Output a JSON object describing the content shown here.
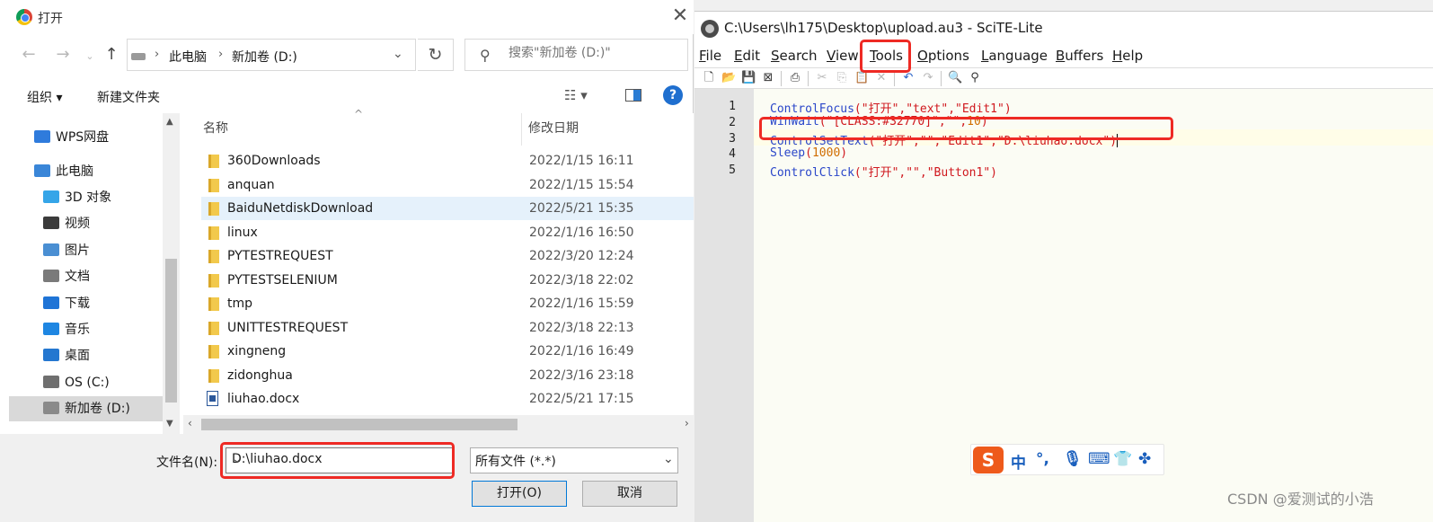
{
  "dialog": {
    "title": "打开",
    "address": {
      "seg1": "此电脑",
      "seg2": "新加卷 (D:)"
    },
    "search_placeholder": "搜索\"新加卷 (D:)\"",
    "cmd": {
      "organize": "组织 ▾",
      "new_folder": "新建文件夹"
    },
    "nav_items": [
      {
        "label": "WPS网盘",
        "icon": "cloud-icon",
        "color": "#2f7bdc"
      },
      {
        "label": "此电脑",
        "icon": "computer-icon",
        "color": "#3a86d8"
      },
      {
        "label": "3D 对象",
        "icon": "cube-icon",
        "color": "#35a5e8"
      },
      {
        "label": "视频",
        "icon": "video-icon",
        "color": "#3b3b3b"
      },
      {
        "label": "图片",
        "icon": "picture-icon",
        "color": "#4a8fd3"
      },
      {
        "label": "文档",
        "icon": "document-icon",
        "color": "#7a7a7a"
      },
      {
        "label": "下载",
        "icon": "download-icon",
        "color": "#1f74d6"
      },
      {
        "label": "音乐",
        "icon": "music-icon",
        "color": "#1e86e2"
      },
      {
        "label": "桌面",
        "icon": "desktop-icon",
        "color": "#2477d0"
      },
      {
        "label": "OS (C:)",
        "icon": "windows-drive-icon",
        "color": "#6f6f6f"
      },
      {
        "label": "新加卷 (D:)",
        "icon": "drive-icon",
        "color": "#8a8a8a"
      }
    ],
    "columns": {
      "name": "名称",
      "date": "修改日期"
    },
    "files": [
      {
        "name": "360Downloads",
        "date": "2022/1/15 16:11",
        "type": "folder"
      },
      {
        "name": "anquan",
        "date": "2022/1/15 15:54",
        "type": "folder"
      },
      {
        "name": "BaiduNetdiskDownload",
        "date": "2022/5/21 15:35",
        "type": "folder"
      },
      {
        "name": "linux",
        "date": "2022/1/16 16:50",
        "type": "folder"
      },
      {
        "name": "PYTESTREQUEST",
        "date": "2022/3/20 12:24",
        "type": "folder"
      },
      {
        "name": "PYTESTSELENIUM",
        "date": "2022/3/18 22:02",
        "type": "folder"
      },
      {
        "name": "tmp",
        "date": "2022/1/16 15:59",
        "type": "folder"
      },
      {
        "name": "UNITTESTREQUEST",
        "date": "2022/3/18 22:13",
        "type": "folder"
      },
      {
        "name": "xingneng",
        "date": "2022/1/16 16:49",
        "type": "folder"
      },
      {
        "name": "zidonghua",
        "date": "2022/3/16 23:18",
        "type": "folder"
      },
      {
        "name": "liuhao.docx",
        "date": "2022/5/21 17:15",
        "type": "docx"
      }
    ],
    "filename_label": "文件名(N):",
    "filename_value": "D:\\liuhao.docx",
    "filetype_value": "所有文件 (*.*)",
    "open_button": "打开(O)",
    "cancel_button": "取消"
  },
  "scite": {
    "title": "C:\\Users\\lh175\\Desktop\\upload.au3 - SciTE-Lite",
    "menu": [
      "File",
      "Edit",
      "Search",
      "View",
      "Tools",
      "Options",
      "Language",
      "Buffers",
      "Help"
    ],
    "line_numbers": [
      "1",
      "2",
      "3",
      "4",
      "5"
    ],
    "code": [
      {
        "fn": "ControlFocus",
        "open": "(",
        "args": "\"打开\",\"text\",\"Edit1\"",
        "close": ")"
      },
      {
        "fn": "WinWait",
        "open": "(",
        "args": "\"[CLASS:#32770]\",\"\",",
        "num": "10",
        "close": ")"
      },
      {
        "fn": "ControlSetText",
        "open": "(",
        "args": "\"打开\",\"\",\"Edit1\",\"D:\\liuhao.docx\"",
        "close": ")"
      },
      {
        "fn": "Sleep",
        "open": "(",
        "num": "1000",
        "close": ")"
      },
      {
        "fn": "ControlClick",
        "open": "(",
        "args": "\"打开\",\"\",\"Button1\"",
        "close": ")"
      }
    ]
  },
  "ime": {
    "logo": "S",
    "mode": "中",
    "punct": "°,"
  },
  "watermark": "CSDN @爱测试的小浩",
  "colors": {
    "highlight_red": "#ee2a24",
    "function_blue": "#2a46c9",
    "string_red": "#d0181e",
    "number_orange": "#d06d00"
  }
}
